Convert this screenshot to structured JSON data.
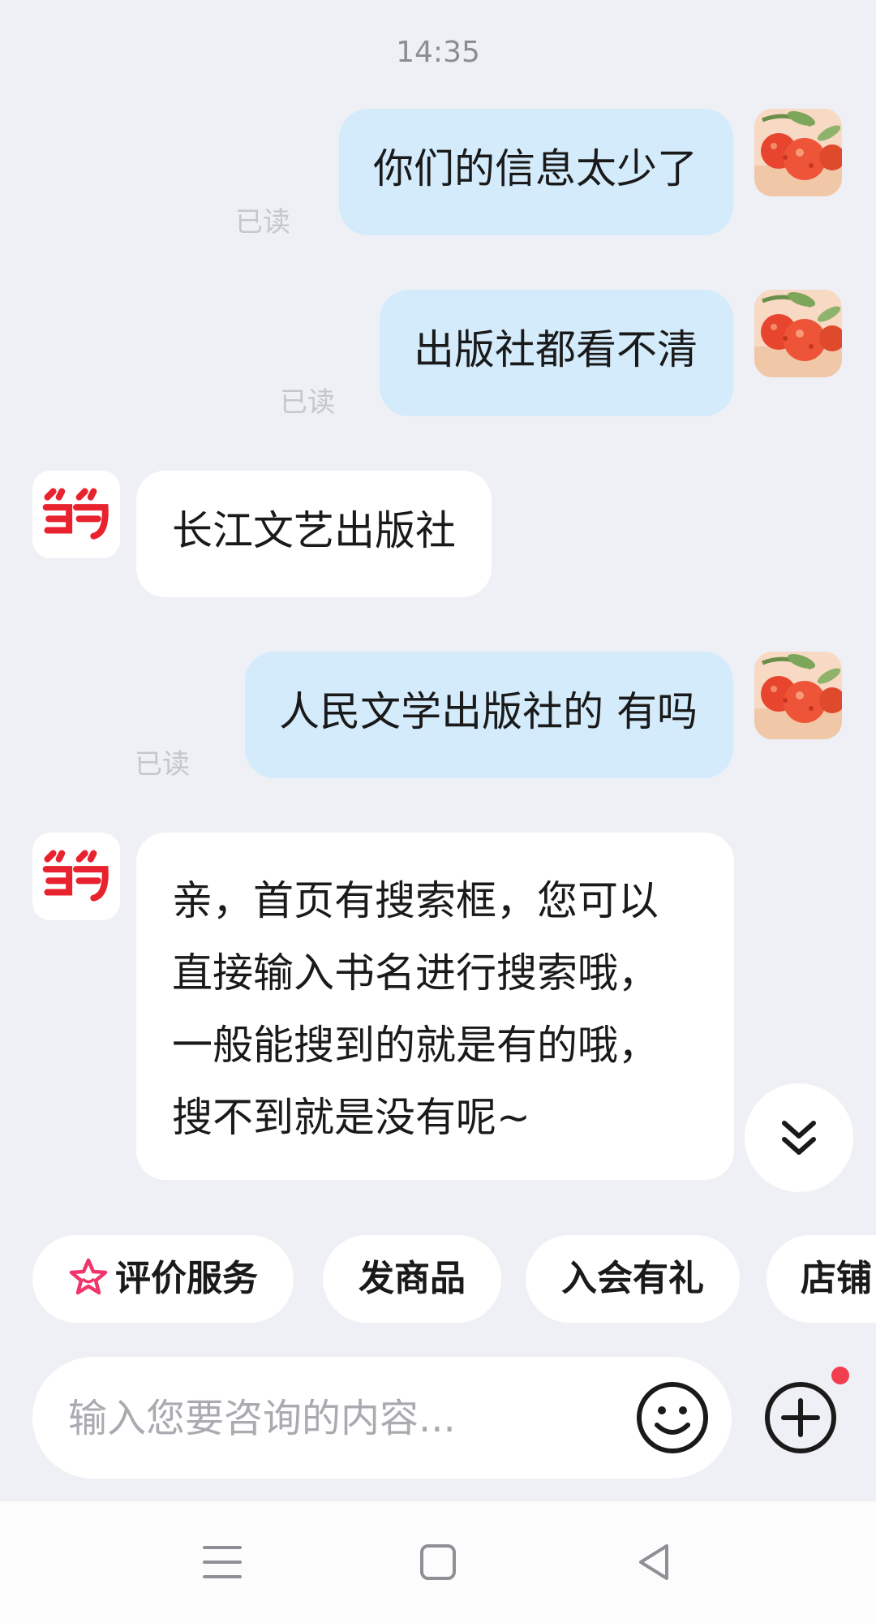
{
  "chat": {
    "timestamp": "14:35",
    "messages": [
      {
        "side": "out",
        "text": "你们的信息太少了",
        "read": "已读"
      },
      {
        "side": "out",
        "text": "出版社都看不清",
        "read": "已读"
      },
      {
        "side": "in",
        "text": "长江文艺出版社"
      },
      {
        "side": "out",
        "text": "人民文学出版社的 有吗",
        "read": "已读"
      },
      {
        "side": "in",
        "text": "亲，首页有搜索框，您可以直接输入书名进行搜索哦，一般能搜到的就是有的哦，搜不到就是没有呢~"
      }
    ]
  },
  "quick_actions": [
    "评价服务",
    "发商品",
    "入会有礼",
    "店铺"
  ],
  "composer": {
    "placeholder": "输入您要咨询的内容...",
    "has_notification": true
  },
  "colors": {
    "background": "#eef0f5",
    "outgoing_bubble": "#d4ebfc",
    "incoming_bubble": "#ffffff",
    "brand_red": "#e8232f",
    "notification_dot": "#f23d4f"
  },
  "icons": {
    "user_avatar": "lychee-avatar",
    "shop_avatar": "dangdang-logo",
    "scroll_down": "double-chevron-down-icon",
    "rating": "star-icon",
    "emoji": "smiley-icon",
    "plus": "plus-circle-icon",
    "nav": [
      "menu-icon",
      "home-square-icon",
      "back-triangle-icon"
    ]
  }
}
